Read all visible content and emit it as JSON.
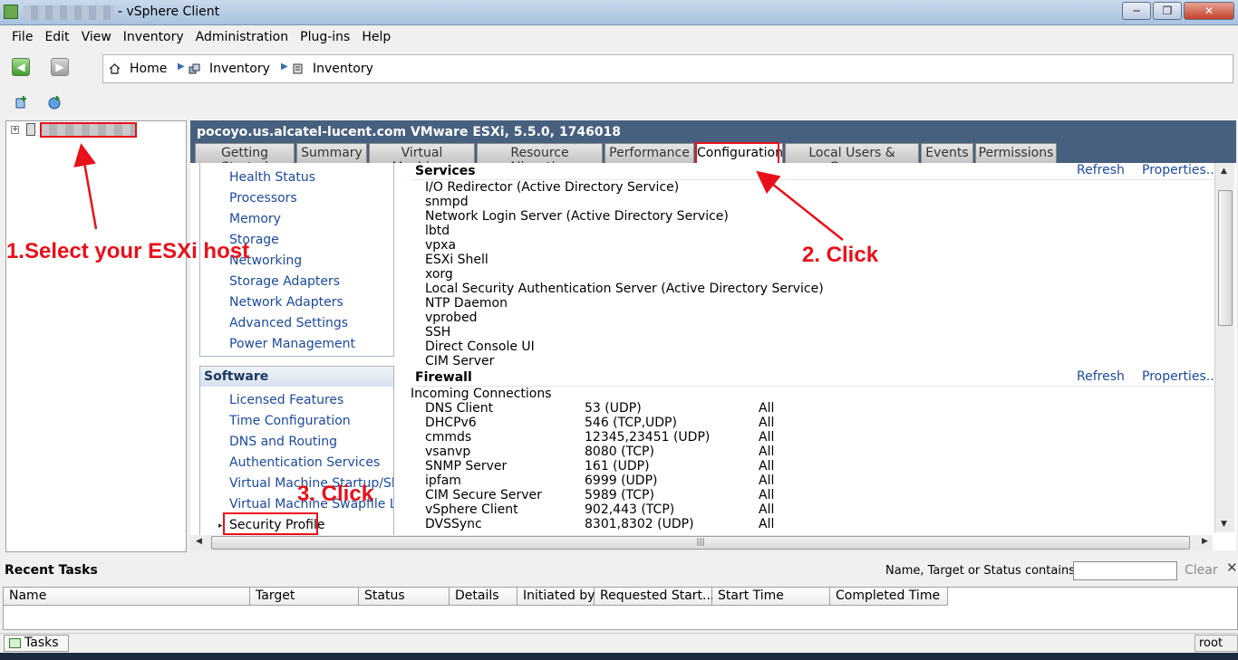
{
  "window": {
    "title": "- vSphere Client",
    "controls": [
      "─",
      "❐",
      "✕"
    ]
  },
  "menu": [
    "File",
    "Edit",
    "View",
    "Inventory",
    "Administration",
    "Plug-ins",
    "Help"
  ],
  "breadcrumb": [
    "Home",
    "Inventory",
    "Inventory"
  ],
  "host": {
    "title": "pocoyo.us.alcatel-lucent.com VMware ESXi, 5.5.0, 1746018"
  },
  "tabs": [
    "Getting Started",
    "Summary",
    "Virtual Machines",
    "Resource Allocation",
    "Performance",
    "Configuration",
    "Local Users & Groups",
    "Events",
    "Permissions"
  ],
  "hardware_links": [
    "Health Status",
    "Processors",
    "Memory",
    "Storage",
    "Networking",
    "Storage Adapters",
    "Network Adapters",
    "Advanced Settings",
    "Power Management"
  ],
  "software": {
    "header": "Software",
    "links": [
      "Licensed Features",
      "Time Configuration",
      "DNS and Routing",
      "Authentication Services",
      "Virtual Machine Startup/Shutd",
      "Virtual Machine Swapfile Locati",
      "Security Profile"
    ]
  },
  "services": {
    "title": "Services",
    "refresh": "Refresh",
    "properties": "Properties...",
    "items": [
      "I/O Redirector (Active Directory Service)",
      "snmpd",
      "Network Login Server (Active Directory Service)",
      "lbtd",
      "vpxa",
      "ESXi Shell",
      "xorg",
      "Local Security Authentication Server (Active Directory Service)",
      "NTP Daemon",
      "vprobed",
      "SSH",
      "Direct Console UI",
      "CIM Server"
    ]
  },
  "firewall": {
    "title": "Firewall",
    "refresh": "Refresh",
    "properties": "Properties...",
    "subtitle": "Incoming Connections",
    "rows": [
      {
        "name": "DNS Client",
        "ports": "53 (UDP)",
        "scope": "All"
      },
      {
        "name": "DHCPv6",
        "ports": "546 (TCP,UDP)",
        "scope": "All"
      },
      {
        "name": "cmmds",
        "ports": "12345,23451 (UDP)",
        "scope": "All"
      },
      {
        "name": "vsanvp",
        "ports": "8080 (TCP)",
        "scope": "All"
      },
      {
        "name": "SNMP Server",
        "ports": "161 (UDP)",
        "scope": "All"
      },
      {
        "name": "ipfam",
        "ports": "6999 (UDP)",
        "scope": "All"
      },
      {
        "name": "CIM Secure Server",
        "ports": "5989 (TCP)",
        "scope": "All"
      },
      {
        "name": "vSphere Client",
        "ports": "902,443 (TCP)",
        "scope": "All"
      },
      {
        "name": "DVSSync",
        "ports": "8301,8302 (UDP)",
        "scope": "All"
      }
    ]
  },
  "recent_tasks": {
    "title": "Recent Tasks",
    "filter_label": "Name, Target or Status contains: ▾",
    "filter_value": "",
    "clear": "Clear",
    "close": "✕",
    "columns": [
      "Name",
      "Target",
      "Status",
      "Details",
      "Initiated by",
      "Requested Start...",
      "Start Time",
      "Completed Time"
    ]
  },
  "statusbar": {
    "tasks_tab": "Tasks",
    "user": "root"
  },
  "annotations": {
    "step1": "1.Select your ESXi host",
    "step2": "2. Click",
    "step3": "3. Click"
  },
  "colors": {
    "header_bg": "#47607f",
    "link": "#1c4a9c",
    "annotation_red": "#e8101a"
  }
}
